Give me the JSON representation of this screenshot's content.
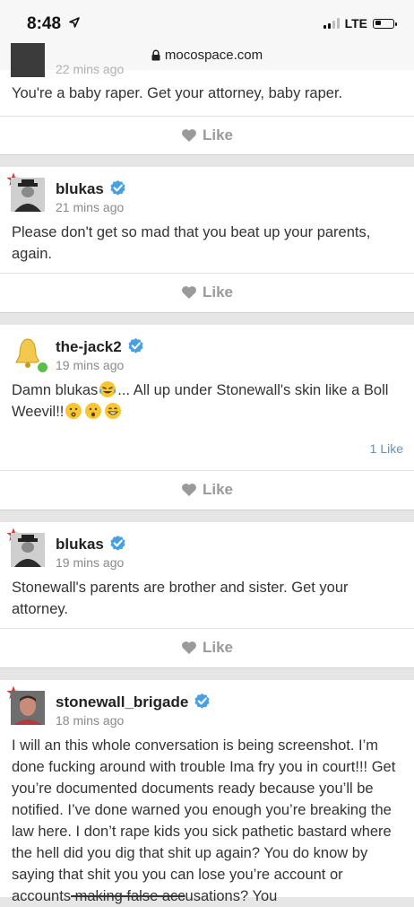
{
  "status_bar": {
    "time": "8:48",
    "network": "LTE"
  },
  "browser": {
    "url": "mocospace.com"
  },
  "like_label": "Like",
  "posts": [
    {
      "timestamp": "22 mins ago",
      "body": "You're a baby raper. Get your attorney, baby raper."
    },
    {
      "username": "blukas",
      "timestamp": "21 mins ago",
      "body": "Please don't get so mad that you beat up your parents, again."
    },
    {
      "username": "the-jack2",
      "timestamp": "19 mins ago",
      "body_part1": "Damn blukas",
      "body_part2": "... All up under Stonewall's skin like a Boll Weevil!!",
      "like_count": "1 Like"
    },
    {
      "username": "blukas",
      "timestamp": "19 mins ago",
      "body": "Stonewall's parents are brother and sister. Get your attorney."
    },
    {
      "username": "stonewall_brigade",
      "timestamp": "18 mins ago",
      "body_main": "I will an this whole conversation is being screenshot. I’m done fucking around with trouble Ima fry you in court!!! Get you’re documented documents ready because you’ll be notified. I’ve done warned you enough you’re breaking the law here. I don’t rape kids you sick pathetic bastard where the hell did you dig that shit up again? You do know by saying that shit you you can lose you’re account or accounts",
      "body_strike": " making false acc",
      "body_end": "usations? You"
    }
  ]
}
